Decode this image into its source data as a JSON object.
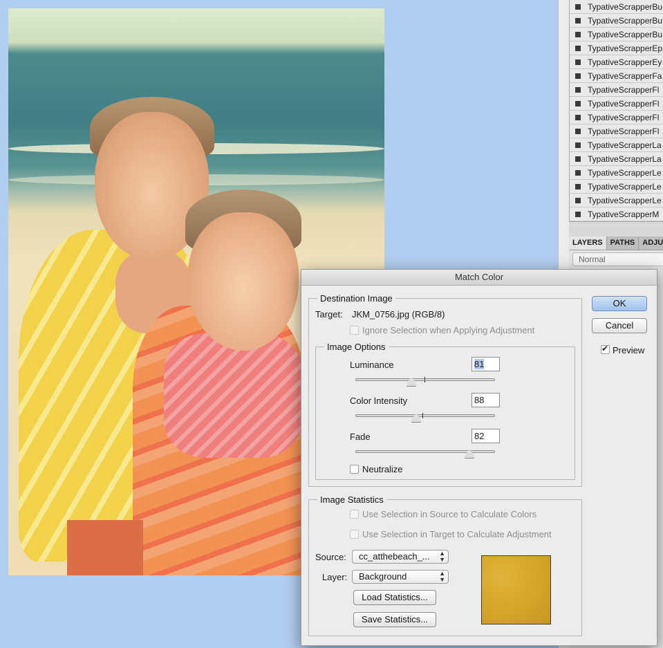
{
  "layers_panel": {
    "items": [
      "TypativeScrapperBu",
      "TypativeScrapperBu",
      "TypativeScrapperBu",
      "TypativeScrapperEp",
      "TypativeScrapperEy",
      "TypativeScrapperFa",
      "TypativeScrapperFl",
      "TypativeScrapperFl",
      "TypativeScrapperFl",
      "TypativeScrapperFl",
      "TypativeScrapperLa",
      "TypativeScrapperLa",
      "TypativeScrapperLe",
      "TypativeScrapperLe",
      "TypativeScrapperLe",
      "TypativeScrapperM"
    ],
    "tabs": [
      "LAYERS",
      "PATHS",
      "ADJU"
    ],
    "blend_mode": "Normal"
  },
  "dialog": {
    "title": "Match Color",
    "destination": {
      "legend": "Destination Image",
      "target_label": "Target:",
      "target_value": "JKM_0756.jpg (RGB/8)",
      "ignore_selection": "Ignore Selection when Applying Adjustment"
    },
    "image_options": {
      "legend": "Image Options",
      "luminance_label": "Luminance",
      "luminance_value": "81",
      "intensity_label": "Color Intensity",
      "intensity_value": "88",
      "fade_label": "Fade",
      "fade_value": "82",
      "neutralize_label": "Neutralize"
    },
    "statistics": {
      "legend": "Image Statistics",
      "use_source": "Use Selection in Source to Calculate Colors",
      "use_target": "Use Selection in Target to Calculate Adjustment",
      "source_label": "Source:",
      "source_value": "cc_atthebeach_...",
      "layer_label": "Layer:",
      "layer_value": "Background",
      "load_button": "Load Statistics...",
      "save_button": "Save Statistics..."
    },
    "ok_button": "OK",
    "cancel_button": "Cancel",
    "preview_label": "Preview",
    "swatch_color": "#d6a52a"
  }
}
